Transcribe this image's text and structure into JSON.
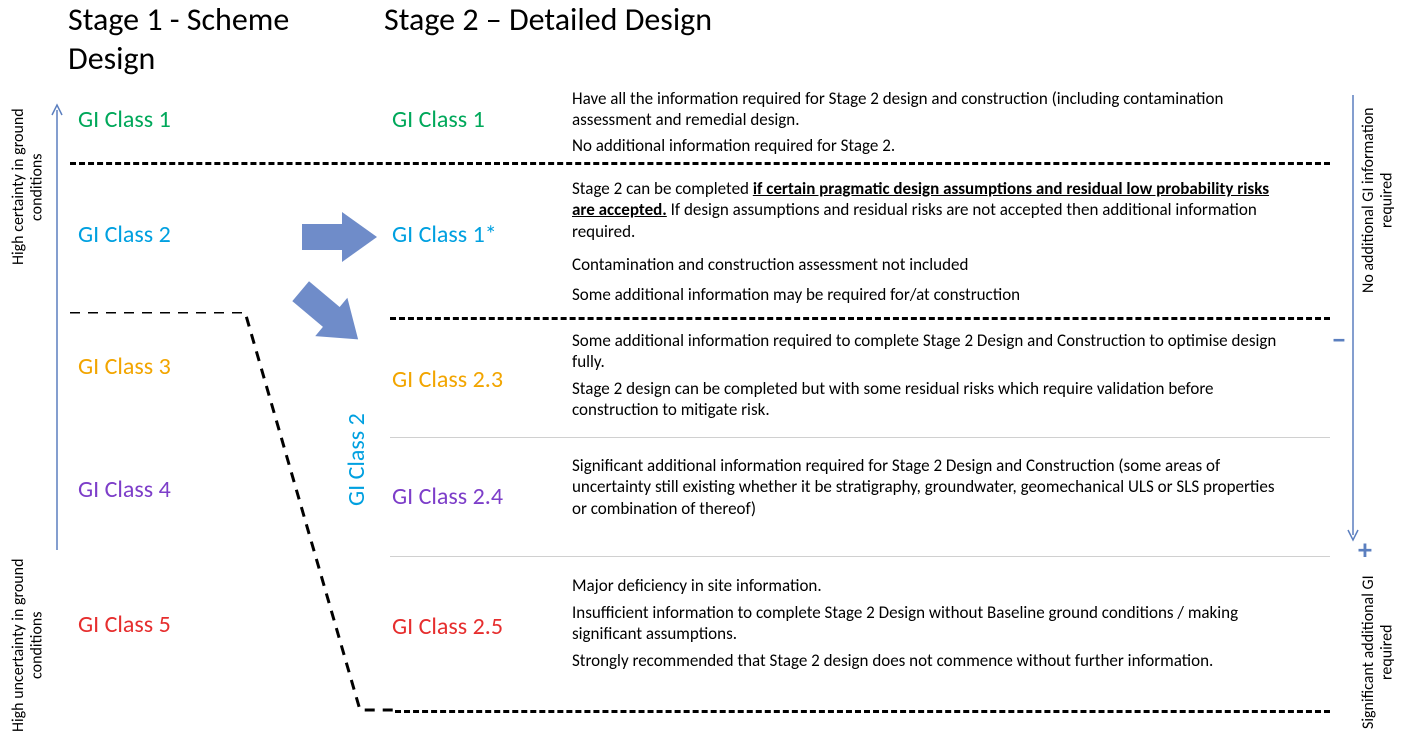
{
  "titles": {
    "stage1": "Stage 1 - Scheme Design",
    "stage2": "Stage 2 – Detailed Design"
  },
  "leftAxis": {
    "top": "High certainty in ground conditions",
    "bottom": "High uncertainty in ground conditions"
  },
  "rightAxis": {
    "top": "No additional GI information required",
    "bottom": "Significant additional GI required",
    "minus": "−",
    "plus": "+"
  },
  "stage1Classes": {
    "c1": "GI Class 1",
    "c2": "GI Class 2",
    "c3": "GI Class 3",
    "c4": "GI Class 4",
    "c5": "GI Class 5"
  },
  "stage2Classes": {
    "c1": "GI Class 1",
    "c1star": "GI Class 1*",
    "c2_3": "GI Class 2.3",
    "c2_4": "GI Class 2.4",
    "c2_5": "GI Class 2.5",
    "c2vert": "GI Class 2"
  },
  "desc": {
    "c1_a": "Have all the information required for Stage 2 design and construction (including contamination assessment and remedial design.",
    "c1_b": "No additional information required for Stage 2.",
    "c1star_a_pre": "Stage 2 can be completed ",
    "c1star_a_bold": "if certain pragmatic design assumptions and residual low probability risks are accepted.",
    "c1star_a_post": " If design assumptions and residual risks are not accepted then additional information required.",
    "c1star_b": "Contamination and construction assessment not included",
    "c1star_c": "Some additional information may be required for/at construction",
    "c2_3_a": "Some additional information required to complete Stage 2 Design and Construction to optimise design fully.",
    "c2_3_b": "Stage 2 design can be completed but with some residual risks which require validation before construction to mitigate risk.",
    "c2_4_a": "Significant additional information required for Stage 2 Design and Construction (some areas of uncertainty still existing whether it be stratigraphy, groundwater, geomechanical ULS or SLS properties or combination of thereof)",
    "c2_5_a": "Major deficiency in site information.",
    "c2_5_b": "Insufficient information to complete Stage 2 Design without Baseline ground conditions / making significant assumptions.",
    "c2_5_c": "Strongly recommended that Stage 2 design does not commence without further information."
  }
}
